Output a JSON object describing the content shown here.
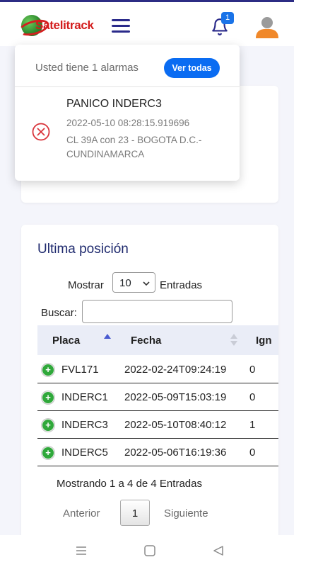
{
  "header": {
    "logo_text": "Satelitrack",
    "notification_count": "1",
    "colors": {
      "brand_red": "#d31c1c",
      "nav_blue": "#2a2a8a",
      "badge_blue": "#1a73e8",
      "avatar_orange": "#f0882a"
    }
  },
  "alarms": {
    "summary": "Usted tiene 1 alarmas",
    "ver_todas_label": "Ver todas",
    "items": [
      {
        "title": "PANICO INDERC3",
        "timestamp": "2022-05-10 08:28:15.919696",
        "address": "CL 39A con 23 - BOGOTA D.C.- CUNDINAMARCA",
        "icon": "x-circle-icon"
      }
    ]
  },
  "position_card": {
    "title": "Ultima posición",
    "show_label": "Mostrar",
    "show_value": "10",
    "entries_label": "Entradas",
    "search_label": "Buscar:",
    "search_value": "",
    "columns": [
      "Placa",
      "Fecha",
      "Ign"
    ],
    "rows": [
      {
        "placa": "FVL171",
        "fecha": "2022-02-24T09:24:19",
        "ign": "0"
      },
      {
        "placa": "INDERC1",
        "fecha": "2022-05-09T15:03:19",
        "ign": "0"
      },
      {
        "placa": "INDERC3",
        "fecha": "2022-05-10T08:40:12",
        "ign": "1"
      },
      {
        "placa": "INDERC5",
        "fecha": "2022-05-06T16:19:36",
        "ign": "0"
      }
    ],
    "info": "Mostrando 1 a 4 de 4 Entradas",
    "pagination": {
      "previous": "Anterior",
      "current_page": "1",
      "next": "Siguiente"
    }
  },
  "system_nav": {
    "icons": [
      "menu-icon",
      "home-square-icon",
      "back-triangle-icon"
    ]
  }
}
